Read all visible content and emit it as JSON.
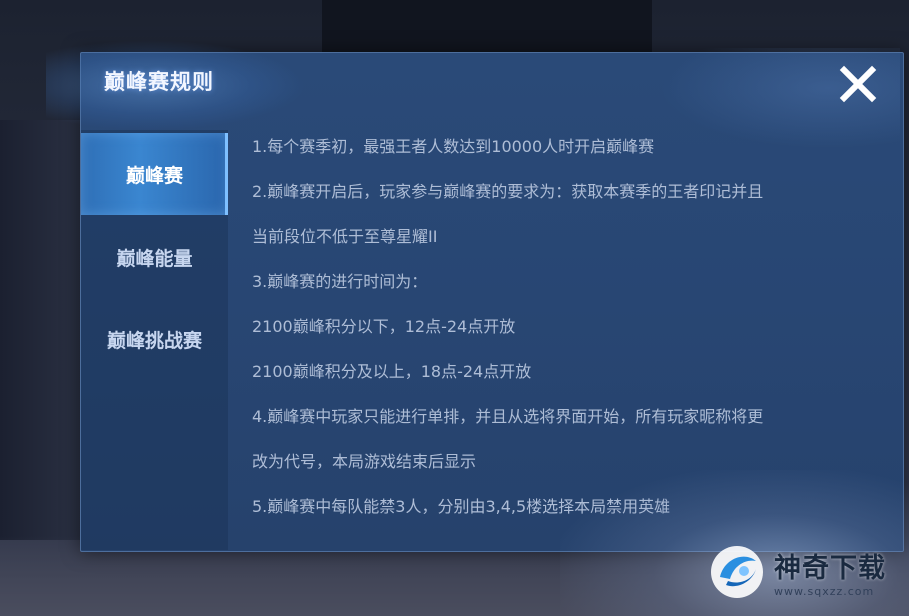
{
  "dialog": {
    "title": "巅峰赛规则",
    "close_icon": "close-icon"
  },
  "tabs": [
    {
      "label": "巅峰赛",
      "active": true
    },
    {
      "label": "巅峰能量",
      "active": false
    },
    {
      "label": "巅峰挑战赛",
      "active": false
    }
  ],
  "rules": [
    "1.每个赛季初，最强王者人数达到10000人时开启巅峰赛",
    "2.巅峰赛开启后，玩家参与巅峰赛的要求为：获取本赛季的王者印记并且",
    "当前段位不低于至尊星耀II",
    "3.巅峰赛的进行时间为：",
    "2100巅峰积分以下，12点-24点开放",
    "2100巅峰积分及以上，18点-24点开放",
    "4.巅峰赛中玩家只能进行单排，并且从选将界面开始，所有玩家昵称将更",
    "改为代号，本局游戏结束后显示",
    "5.巅峰赛中每队能禁3人，分别由3,4,5楼选择本局禁用英雄"
  ],
  "watermark": {
    "name": "神奇下载",
    "url": "www.sqxzz.com"
  },
  "colors": {
    "dialog_bg": "#284673",
    "active_tab": "#3a86d0",
    "text": "#aebdd6",
    "title": "#f2f6ff"
  }
}
